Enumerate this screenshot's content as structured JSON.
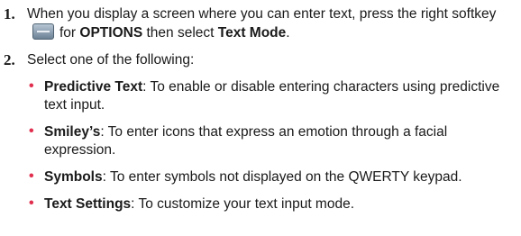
{
  "steps": [
    {
      "number": "1.",
      "text_before": "When you display a screen where you can enter text, press the right softkey",
      "softkey_icon": "right-softkey-icon",
      "text_for": "for",
      "options_label": "OPTIONS",
      "text_then": "then select",
      "text_mode_label": "Text Mode",
      "period": "."
    },
    {
      "number": "2.",
      "text": "Select one of the following:"
    }
  ],
  "options": [
    {
      "term": "Predictive Text",
      "description": ": To enable or disable entering characters using predictive text input."
    },
    {
      "term": "Smiley’s",
      "description": ": To enter icons that express an emotion through a facial expression."
    },
    {
      "term": "Symbols",
      "description": ": To enter symbols not displayed on the QWERTY keypad."
    },
    {
      "term": "Text Settings",
      "description": ": To customize your text input mode."
    }
  ],
  "colors": {
    "bullet": "#e1304f",
    "text": "#1a1a1a"
  }
}
